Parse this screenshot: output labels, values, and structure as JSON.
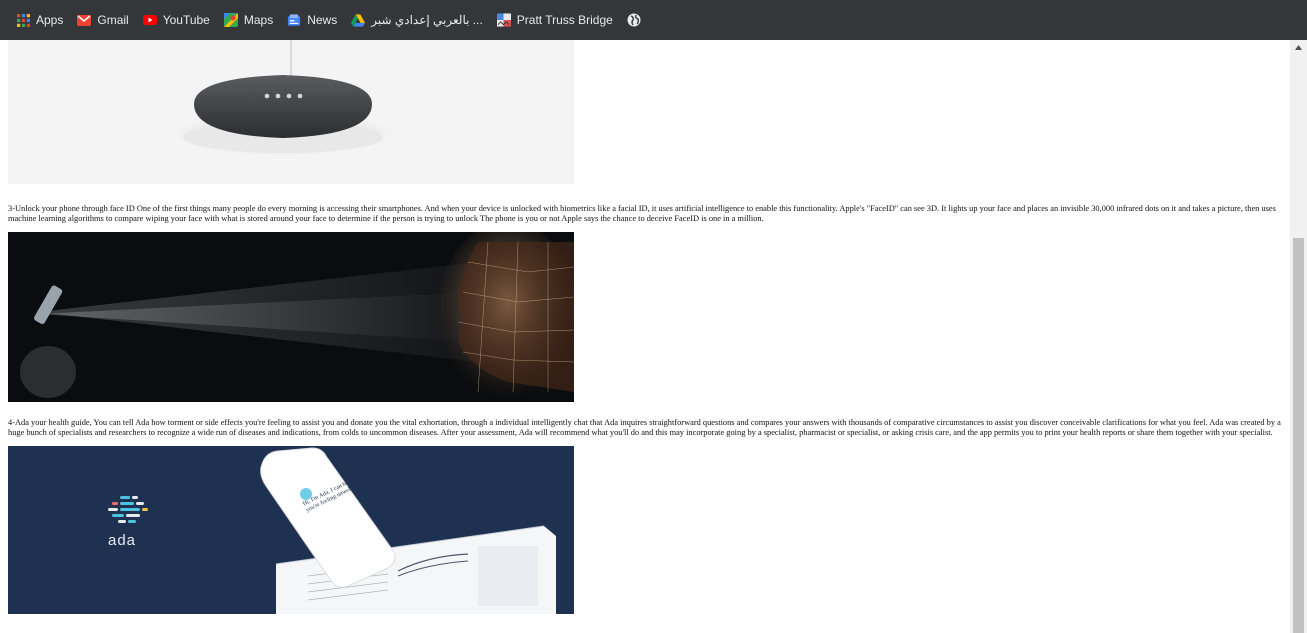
{
  "bookmarks": [
    {
      "label": "Apps",
      "icon": "apps-grid-icon"
    },
    {
      "label": "Gmail",
      "icon": "gmail-icon"
    },
    {
      "label": "YouTube",
      "icon": "youtube-icon"
    },
    {
      "label": "Maps",
      "icon": "maps-icon"
    },
    {
      "label": "News",
      "icon": "news-icon"
    },
    {
      "label": "بالعربي إعدادي شبر ...",
      "icon": "drive-icon"
    },
    {
      "label": "Pratt Truss Bridge",
      "icon": "bridge-site-icon"
    },
    {
      "label": "",
      "icon": "globe-icon"
    }
  ],
  "article": {
    "para3": "3-Unlock your phone through face ID One of the first things many people do every morning is accessing their smartphones. And when your device is unlocked with biometrics like a facial ID, it uses artificial intelligence to enable this functionality. Apple's \"FaceID\" can see 3D. It lights up your face and places an invisible 30,000 infrared dots on it and takes a picture, then uses machine learning algorithms to compare wiping your face with what is stored around your face to determine if the person is trying to unlock The phone is you or not Apple says the chance to deceive FaceID is one in a million.",
    "para4": "4-Ada your health guide, You can tell Ada how torment or side effects you're feeling to assist you and donate you the vital exhortation, through a individual intelligently chat that Ada inquires straightforward questions and compares your answers with thousands of comparative circumstances to assist you discover conceivable clarifications for what you feel. Ada was created by a huge bunch of specialists and researchers to recognize a wide run of diseases and indications, from colds to uncommon diseases. After your assessment, Ada will recommend what you'll do and this may incorporate going by a specialist, pharmacist or specialist, or asking crisis care, and the app permits you to print your health reports or share them together with your specialist.",
    "ada_logo_text": "ada",
    "ada_chat_text": "Hi, I'm Ada. I can help if you're feeling unwell."
  },
  "colors": {
    "bookmark_bar": "#35363a",
    "ada_background": "#1f3150",
    "scrollbar_thumb": "#c1c1c1"
  }
}
